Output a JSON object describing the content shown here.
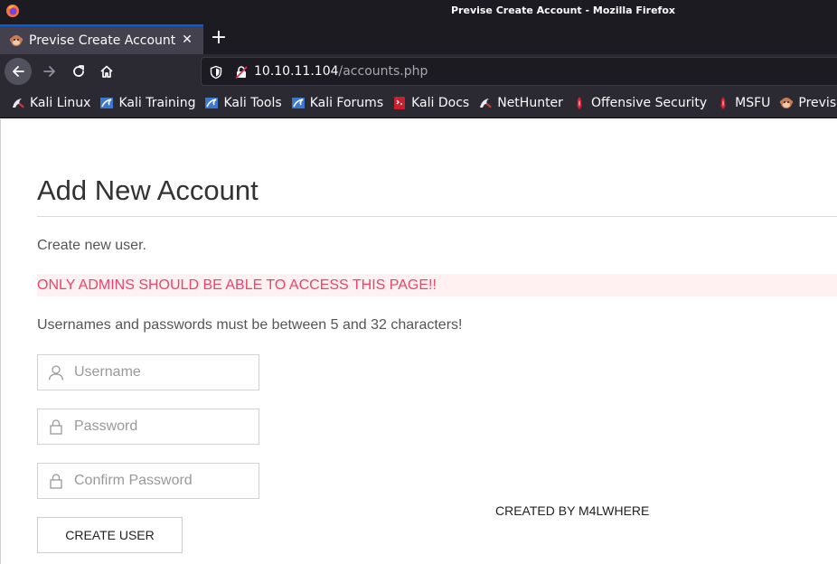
{
  "window": {
    "title": "Previse Create Account - Mozilla Firefox"
  },
  "tabs": [
    {
      "label": "Previse Create Account",
      "active": true
    }
  ],
  "navbar": {
    "url_host": "10.10.11.104",
    "url_path": "/accounts.php"
  },
  "bookmarks": [
    {
      "label": "Kali Linux",
      "icon": "kali-dragon-icon"
    },
    {
      "label": "Kali Training",
      "icon": "kali-training-icon"
    },
    {
      "label": "Kali Tools",
      "icon": "kali-tools-icon"
    },
    {
      "label": "Kali Forums",
      "icon": "kali-forums-icon"
    },
    {
      "label": "Kali Docs",
      "icon": "kali-docs-icon"
    },
    {
      "label": "NetHunter",
      "icon": "nethunter-icon"
    },
    {
      "label": "Offensive Security",
      "icon": "offsec-icon"
    },
    {
      "label": "MSFU",
      "icon": "msfu-icon"
    },
    {
      "label": "Previse Lo",
      "icon": "previse-icon"
    }
  ],
  "page": {
    "title": "Add New Account",
    "subtitle": "Create new user.",
    "alert": "ONLY ADMINS SHOULD BE ABLE TO ACCESS THIS PAGE!!",
    "rule": "Usernames and passwords must be between 5 and 32 characters!",
    "fields": {
      "username_placeholder": "Username",
      "password_placeholder": "Password",
      "confirm_placeholder": "Confirm Password"
    },
    "submit_label": "CREATE USER",
    "credit": "CREATED BY M4LWHERE"
  },
  "colors": {
    "alert_text": "#e8456b",
    "alert_bg": "#fff0f1",
    "active_tab_accent": "#0060df"
  }
}
